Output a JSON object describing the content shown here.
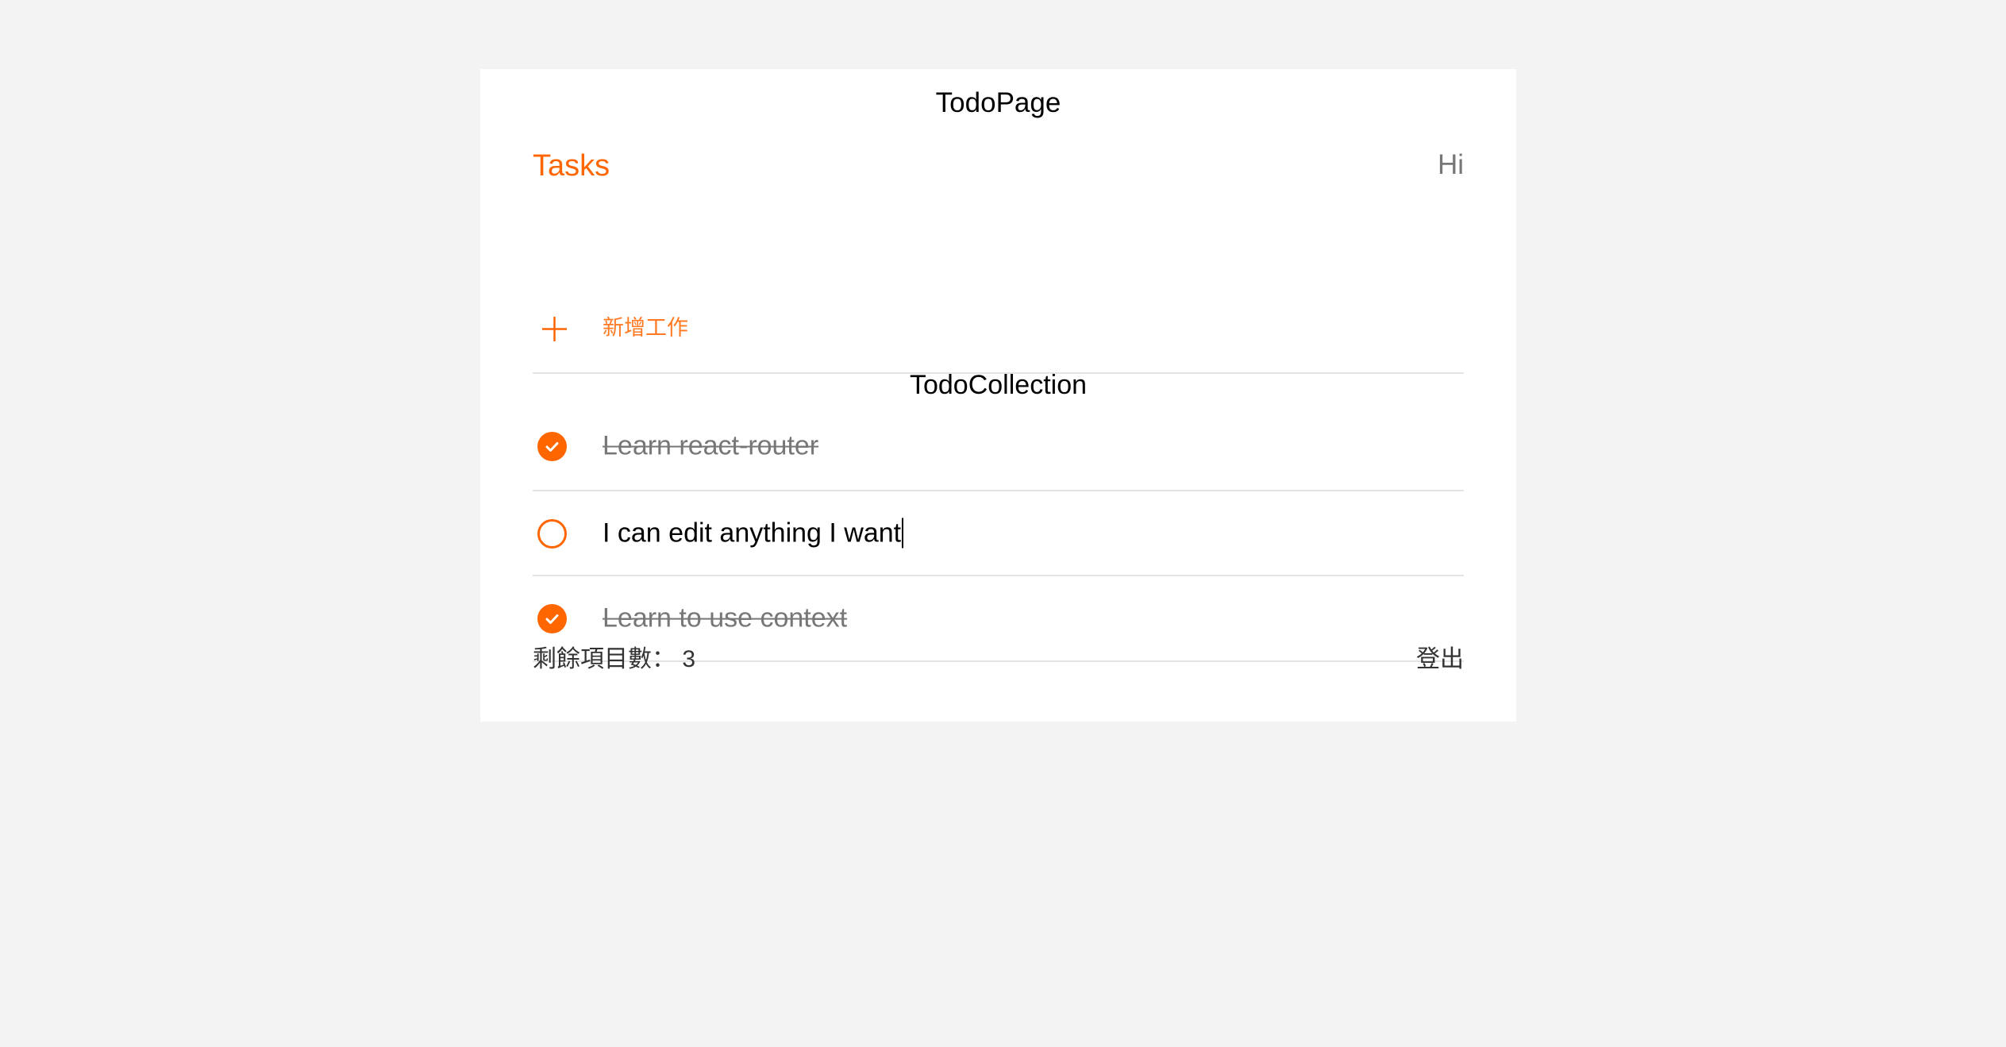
{
  "page_title": "TodoPage",
  "header": {
    "title": "Tasks",
    "greeting": "Hi"
  },
  "add_task": {
    "placeholder": "新增工作",
    "icon": "plus-icon"
  },
  "collection_title": "TodoCollection",
  "todos": [
    {
      "text": "Learn react-router",
      "done": true
    },
    {
      "text": "I can edit anything I want",
      "done": false,
      "editing": true
    },
    {
      "text": "Learn to use context",
      "done": true
    }
  ],
  "footer": {
    "remaining_label": "剩餘項目數：",
    "remaining_count": "3",
    "logout_label": "登出"
  },
  "colors": {
    "accent": "#ff6600",
    "background": "#f3f3f3",
    "card": "#ffffff",
    "divider": "#e4e4e4",
    "muted_text": "#777777"
  }
}
